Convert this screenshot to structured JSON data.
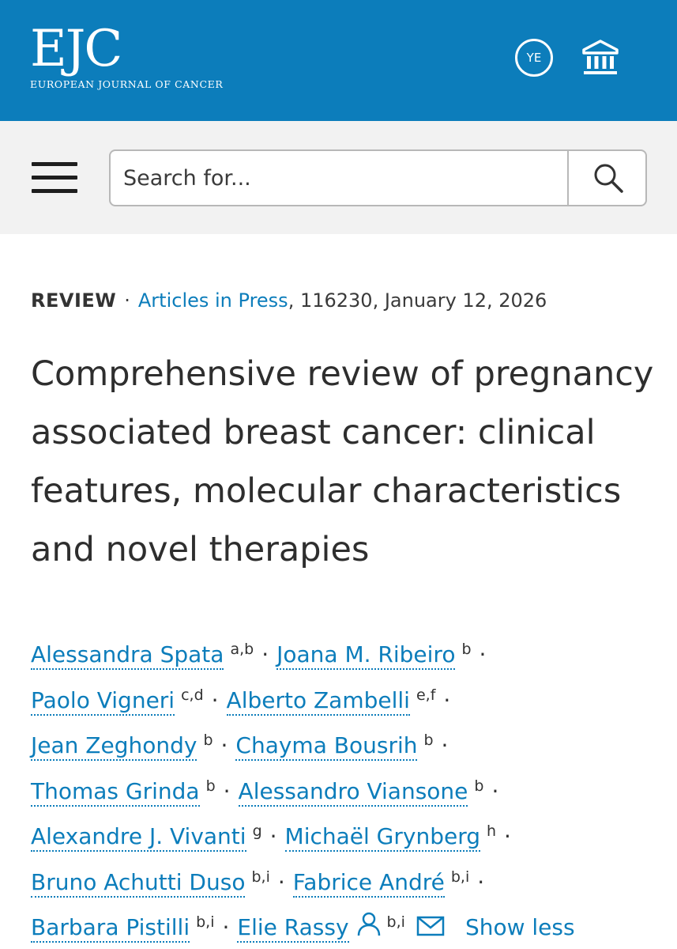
{
  "header": {
    "logo_main": "EJC",
    "logo_sub": "EUROPEAN JOURNAL OF CANCER",
    "user_initials": "YE",
    "institution_icon": "institution-icon",
    "background_color": "#0c7dbb"
  },
  "search": {
    "placeholder": "Search for...",
    "menu_icon": "hamburger-menu-icon",
    "search_icon": "search-icon"
  },
  "article": {
    "type": "REVIEW",
    "separator": "·",
    "issue_link": "Articles in Press",
    "meta_rest": ", 116230, January 12, 2026",
    "title": "Comprehensive review of pregnancy associated breast cancer: clinical features, molecular characteristics and novel therapies"
  },
  "authors": [
    {
      "name": "Alessandra Spata",
      "aff": "a,b"
    },
    {
      "name": "Joana M. Ribeiro",
      "aff": "b"
    },
    {
      "name": "Paolo Vigneri",
      "aff": "c,d"
    },
    {
      "name": "Alberto Zambelli",
      "aff": "e,f"
    },
    {
      "name": "Jean Zeghondy",
      "aff": "b"
    },
    {
      "name": "Chayma Bousrih",
      "aff": "b"
    },
    {
      "name": "Thomas Grinda",
      "aff": "b"
    },
    {
      "name": "Alessandro Viansone",
      "aff": "b"
    },
    {
      "name": "Alexandre J. Vivanti",
      "aff": "g"
    },
    {
      "name": "Michaël Grynberg",
      "aff": "h"
    },
    {
      "name": "Bruno Achutti Duso",
      "aff": "b,i"
    },
    {
      "name": "Fabrice André",
      "aff": "b,i"
    },
    {
      "name": "Barbara Pistilli",
      "aff": "b,i"
    },
    {
      "name": "Elie Rassy",
      "aff": "b,i"
    }
  ],
  "author_separator": "·",
  "show_less_label": "Show less",
  "colors": {
    "link": "#0c7dbb",
    "text": "#2e2e2e",
    "search_background": "#f2f2f2"
  }
}
